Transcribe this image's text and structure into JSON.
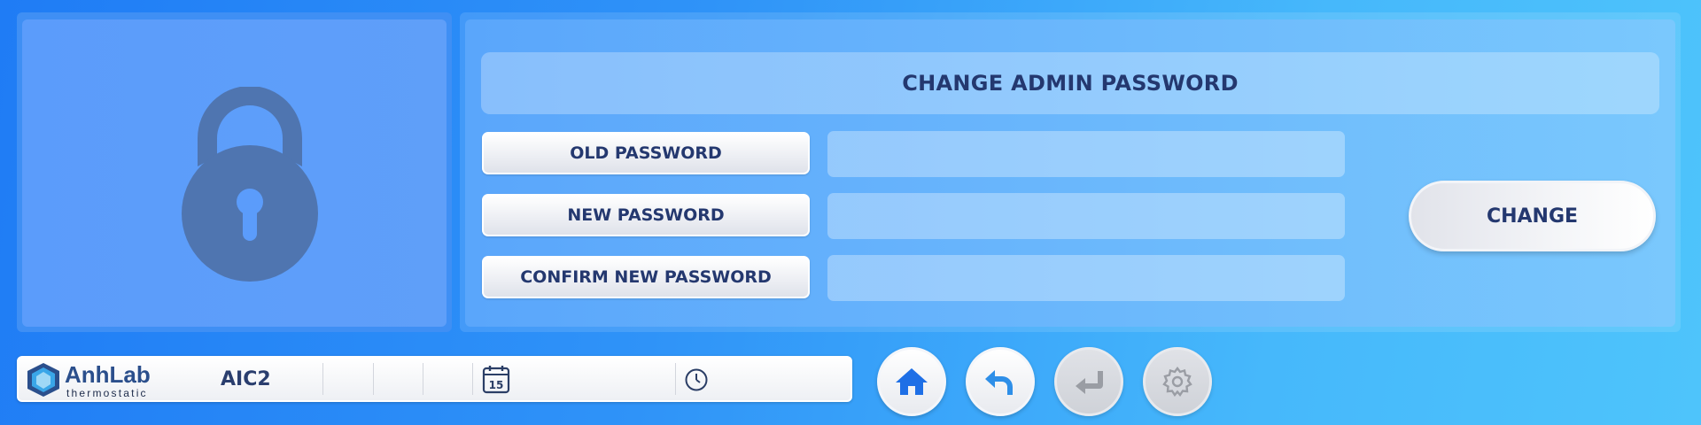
{
  "header": {
    "title": "CHANGE ADMIN PASSWORD"
  },
  "form": {
    "old_password_label": "OLD PASSWORD",
    "new_password_label": "NEW PASSWORD",
    "confirm_password_label": "CONFIRM NEW PASSWORD",
    "old_password_value": "",
    "new_password_value": "",
    "confirm_password_value": "",
    "change_label": "CHANGE"
  },
  "status_bar": {
    "brand": "AnhLab",
    "brand_sub": "thermostatic",
    "device_name": "AIC2",
    "calendar_day": "15",
    "date": "",
    "time": ""
  },
  "nav": {
    "home_icon": "home-icon",
    "back_icon": "undo-arrow-icon",
    "enter_icon": "enter-return-icon",
    "settings_icon": "gear-icon"
  },
  "colors": {
    "text_dark": "#24386f",
    "accent_blue": "#1f7cf5",
    "lock_color": "#4f75b0"
  }
}
